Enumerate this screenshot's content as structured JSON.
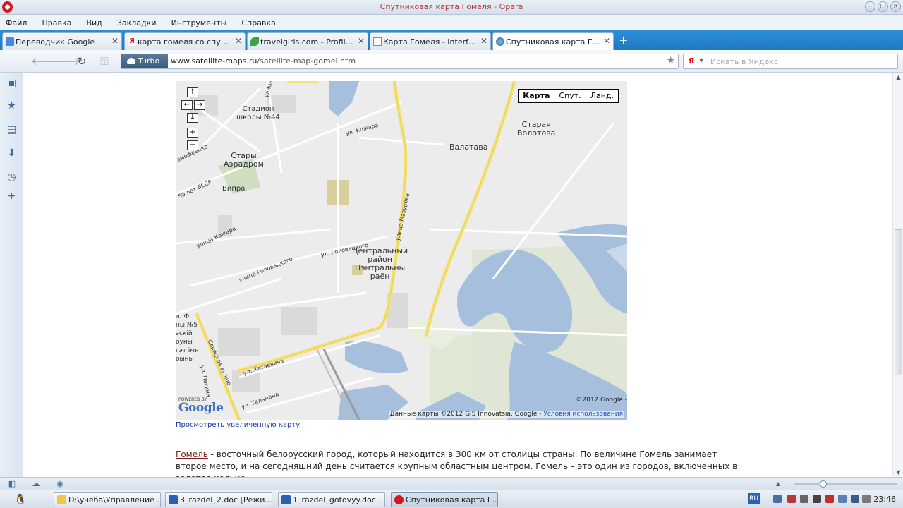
{
  "window": {
    "title": "Спутниковая карта Гомеля - Opera"
  },
  "menu": [
    "Файл",
    "Правка",
    "Вид",
    "Закладки",
    "Инструменты",
    "Справка"
  ],
  "tabs": [
    {
      "label": "Переводчик Google",
      "icon": "google-translate-icon",
      "active": false
    },
    {
      "label": "карта гомеля со спутни...",
      "icon": "yandex-icon",
      "active": false
    },
    {
      "label": "travelgirls.com - Profile v...",
      "icon": "leaf-icon",
      "active": false
    },
    {
      "label": "Карта Гомеля - Interfax...",
      "icon": "page-icon",
      "active": false
    },
    {
      "label": "Спутниковая карта Го...",
      "icon": "globe-icon",
      "active": true
    }
  ],
  "nav": {
    "turbo": "Turbo",
    "url_domain": "www.satellite-maps.ru",
    "url_path": "/satellite-map-gomel.htm",
    "search_placeholder": "Искать в Яндекс",
    "search_engine": "Я"
  },
  "map": {
    "type_buttons": [
      "Карта",
      "Спут.",
      "Ланд."
    ],
    "labels": {
      "stadium": "Стадион\nшколы №44",
      "aero": "Стары\nАэрадром",
      "vipra": "Випра",
      "valatava": "Валатава",
      "staraya": "Старая\nВолотова",
      "central": "Центральный\nрайон\nЦэнтральны\nраён",
      "kozhara1": "ул. Кожара",
      "kozhara2": "улица Кожара",
      "mazurova": "улица Мазурова",
      "golov1": "ул. Головацкого",
      "golov2": "улица Головацкого",
      "khataevicha": "ул. Хатаевича",
      "savitskaya": "Савицкая вуліца",
      "pesina": "ул. Песина",
      "telmana": "ул. Тельмана",
      "bssr": "50 лет БССР",
      "mofeenko": "амофеенко",
      "ulitsa_top": "улица",
      "left_edge": "л. Ф.\nны №5\nэскій\nоуны\nгэт імя\nоыны"
    },
    "copyright": "©2012 Google -",
    "attribution_prefix": "Данные карты ©2012 GIS Innovatsia, Google -",
    "terms_link": "Условия использования",
    "powered_by": "POWERED BY",
    "google_logo": "Google"
  },
  "content": {
    "bigger_map_link": "Просмотреть увеличенную карту",
    "city_link": "Гомель",
    "paragraph": " - восточный белорусский город, который находится в 300 км от столицы страны. По величине Гомель занимает второе место, и на сегодняшний день считается крупным областным центром. Гомель – это один из городов, включенных в золотое кольцо"
  },
  "taskbar": {
    "tasks": [
      {
        "label": "D:\\учёба\\Управление ...",
        "icon": "folder-icon",
        "active": false
      },
      {
        "label": "3_razdel_2.doc [Режи...",
        "icon": "word-icon",
        "active": false
      },
      {
        "label": "1_razdel_gotovyy.doc ...",
        "icon": "word-icon",
        "active": false
      },
      {
        "label": "Спутниковая карта Г...",
        "icon": "opera-icon",
        "active": true
      }
    ],
    "lang": "RU",
    "clock": "23:46"
  },
  "colors": {
    "tabbar": "#2a8fd6",
    "water": "#a5bfdd",
    "road_major": "#f7e47a",
    "map_bg": "#ececec",
    "green": "#d6e4c4"
  }
}
